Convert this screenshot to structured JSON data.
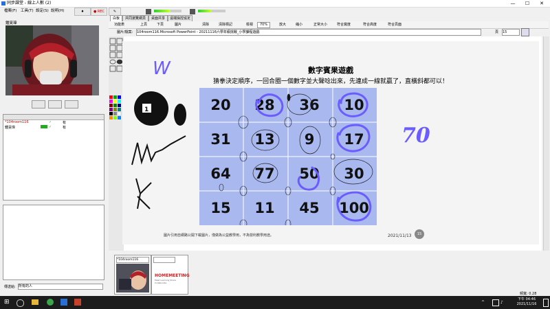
{
  "window": {
    "title": "同步課堂 - 線上人數 (2)"
  },
  "menu": {
    "items": [
      "檔案(F)",
      "工具(T)",
      "設定(S)",
      "說明(H)"
    ]
  },
  "toolbar": {
    "rec_label": "● REC"
  },
  "left": {
    "webcam_label": "鍾旻瑋",
    "users": [
      {
        "name": "*104room116",
        "status": "有"
      },
      {
        "name": "鍾旻瑋",
        "status": "有"
      }
    ],
    "send_to_label": "傳送給:",
    "send_to_value": "所有的人"
  },
  "tabs": [
    "白板",
    "共同瀏覽網頁",
    "桌面共享",
    "遠端操控協定"
  ],
  "subtoolbar": {
    "items": [
      "功能表",
      "上頁",
      "下頁",
      "圖片",
      "清除",
      "清除標記",
      "檢視",
      "70%",
      "放大",
      "縮小",
      "正常大小",
      "符合寬度",
      "符合高度",
      "符合頁面"
    ]
  },
  "filebar": {
    "label": "圖片/檔案:",
    "filename": "104room116.Microsoft PowerPoint - 20211116六學年級挑戰_小學課程遊戲",
    "page_label": "頁",
    "page": "15"
  },
  "slide": {
    "title": "數字賓果遊戲",
    "subtitle": "猜拳決定順序，一回合圈一個數字並大聲唸出來，先連成一線就贏了，直橫斜都可以！",
    "grid": [
      [
        "20",
        "28",
        "36",
        "10"
      ],
      [
        "31",
        "13",
        "9",
        "17"
      ],
      [
        "64",
        "77",
        "50",
        "30"
      ],
      [
        "15",
        "11",
        "45",
        "100"
      ]
    ],
    "footer": "圖片引用自網路公開下載圖片，僅做為公益教學用，不為營利教學用途。",
    "date": "2021/11/13",
    "page_number": "15",
    "handwriting_70": "70",
    "handwriting_w": "W"
  },
  "thumbnails": {
    "tile_label": "*104room116",
    "logo_text": "HOMEMEETING",
    "logo_sub": "Meet Learning Share Collaborate"
  },
  "status": {
    "traffic": "頻寬: 0.28"
  },
  "taskbar": {
    "time": "下午 04:46",
    "date": "2021/11/16"
  },
  "colors": {
    "grid_fill": "#a9b8ee",
    "ink_blue": "#6a5cff",
    "stroke_dark": "#111111"
  }
}
